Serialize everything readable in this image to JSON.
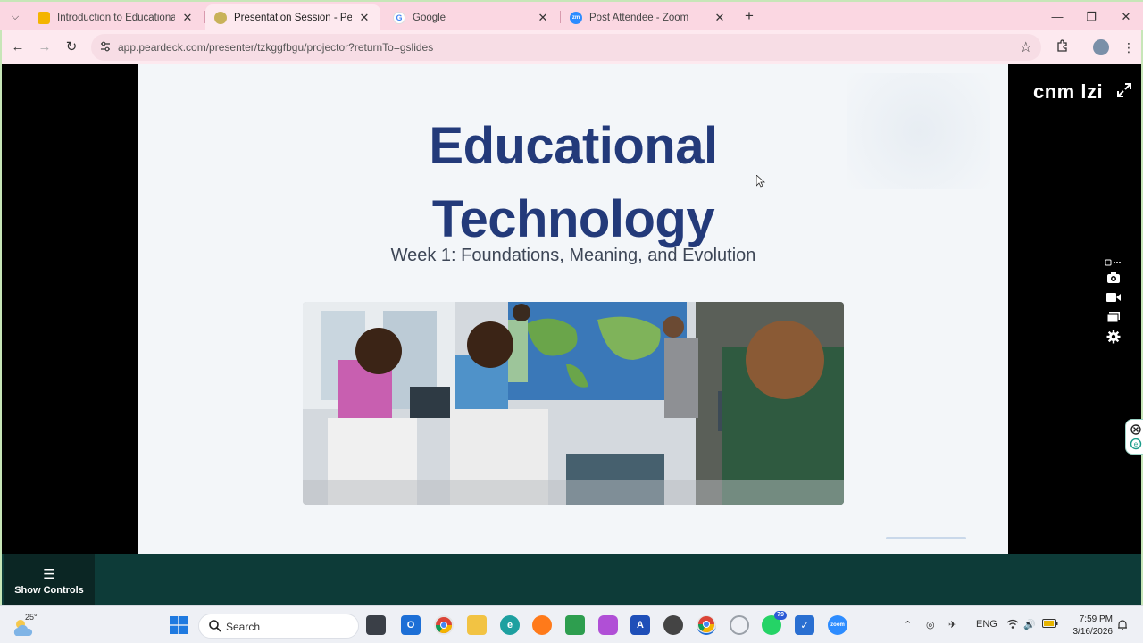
{
  "browser": {
    "tabs": [
      {
        "title": "Introduction to Educational Te",
        "favicon": "slides-icon",
        "active": false
      },
      {
        "title": "Presentation Session - Pear Dec",
        "favicon": "peardeck-icon",
        "active": true
      },
      {
        "title": "Google",
        "favicon": "google-icon",
        "active": false
      },
      {
        "title": "Post Attendee - Zoom",
        "favicon": "zoom-icon",
        "active": false
      }
    ],
    "url": "app.peardeck.com/presenter/tzkggfbgu/projector?returnTo=gslides"
  },
  "slide": {
    "title_line1": "Educational",
    "title_line2": "Technology",
    "subtitle": "Week 1: Foundations, Meaning, and Evolution"
  },
  "projector": {
    "join_code": "cnm lzi"
  },
  "controls": {
    "show_controls_label": "Show Controls"
  },
  "taskbar": {
    "weather_temp": "25°",
    "search_label": "Search",
    "whatsapp_badge": "79",
    "language": "ENG",
    "time": "7:59 PM",
    "date": "3/16/2026"
  },
  "colors": {
    "tab_strip": "#fbd7e2",
    "title_blue": "#233a7a",
    "control_bar": "#0d3b38"
  }
}
